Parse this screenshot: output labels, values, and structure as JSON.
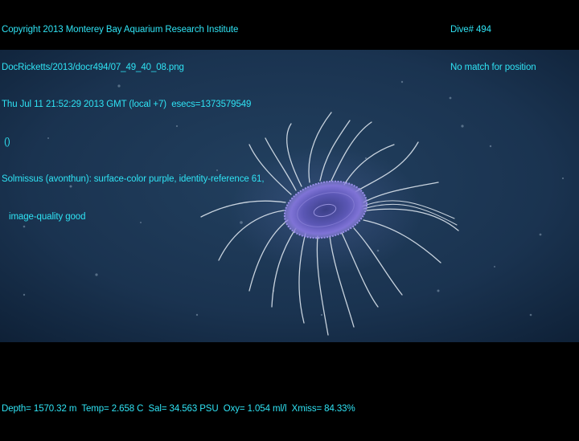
{
  "header": {
    "copyright": "Copyright 2013 Monterey Bay Aquarium Research Institute",
    "file_path": "DocRicketts/2013/docr494/07_49_40_08.png",
    "timestamp": "Thu Jul 11 21:52:29 2013 GMT (local +7)  esecs=1373579549",
    "blank_parens": " ()",
    "annotation_line1": "Solmissus (avonthun): surface-color purple, identity-reference 61,",
    "annotation_line2": "image-quality good",
    "dive": "Dive# 494",
    "position_status": "No match for position"
  },
  "footer": {
    "telemetry": "Depth= 1570.32 m  Temp= 2.658 C  Sal= 34.563 PSU  Oxy= 1.054 ml/l  Xmiss= 84.33%"
  },
  "colors": {
    "overlay_text": "#2fe3f4",
    "water_center": "#1e3a5a",
    "water_edge": "#0f2238",
    "medusa_bell": "#6f62c9",
    "tentacle": "#e6eef6"
  },
  "scene": {
    "subject": "jellyfish-icon"
  }
}
